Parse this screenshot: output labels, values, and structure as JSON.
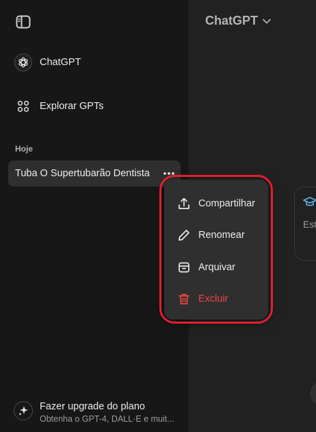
{
  "sidebar": {
    "nav": [
      {
        "label": "ChatGPT",
        "icon": "chatgpt-logo-icon"
      },
      {
        "label": "Explorar GPTs",
        "icon": "grid-icon"
      }
    ],
    "section_label": "Hoje",
    "chats": [
      {
        "title": "Tuba O Supertubarão Dentista",
        "options_icon": "ellipsis-icon"
      }
    ],
    "upgrade": {
      "title": "Fazer upgrade do plano",
      "subtitle": "Obtenha o GPT-4, DALL·E e muit..."
    }
  },
  "header": {
    "model_label": "ChatGPT"
  },
  "prompt_card": {
    "text": "Est"
  },
  "context_menu": {
    "items": [
      {
        "label": "Compartilhar",
        "icon": "share-icon"
      },
      {
        "label": "Renomear",
        "icon": "pencil-icon"
      },
      {
        "label": "Arquivar",
        "icon": "archive-icon"
      },
      {
        "label": "Excluir",
        "icon": "trash-icon",
        "danger": true
      }
    ]
  },
  "colors": {
    "sidebar_bg": "#171717",
    "main_bg": "#212121",
    "menu_bg": "#2f2f2f",
    "danger": "#ef4444",
    "highlight": "#e0202e",
    "accent_cap": "#5bb8e8"
  }
}
